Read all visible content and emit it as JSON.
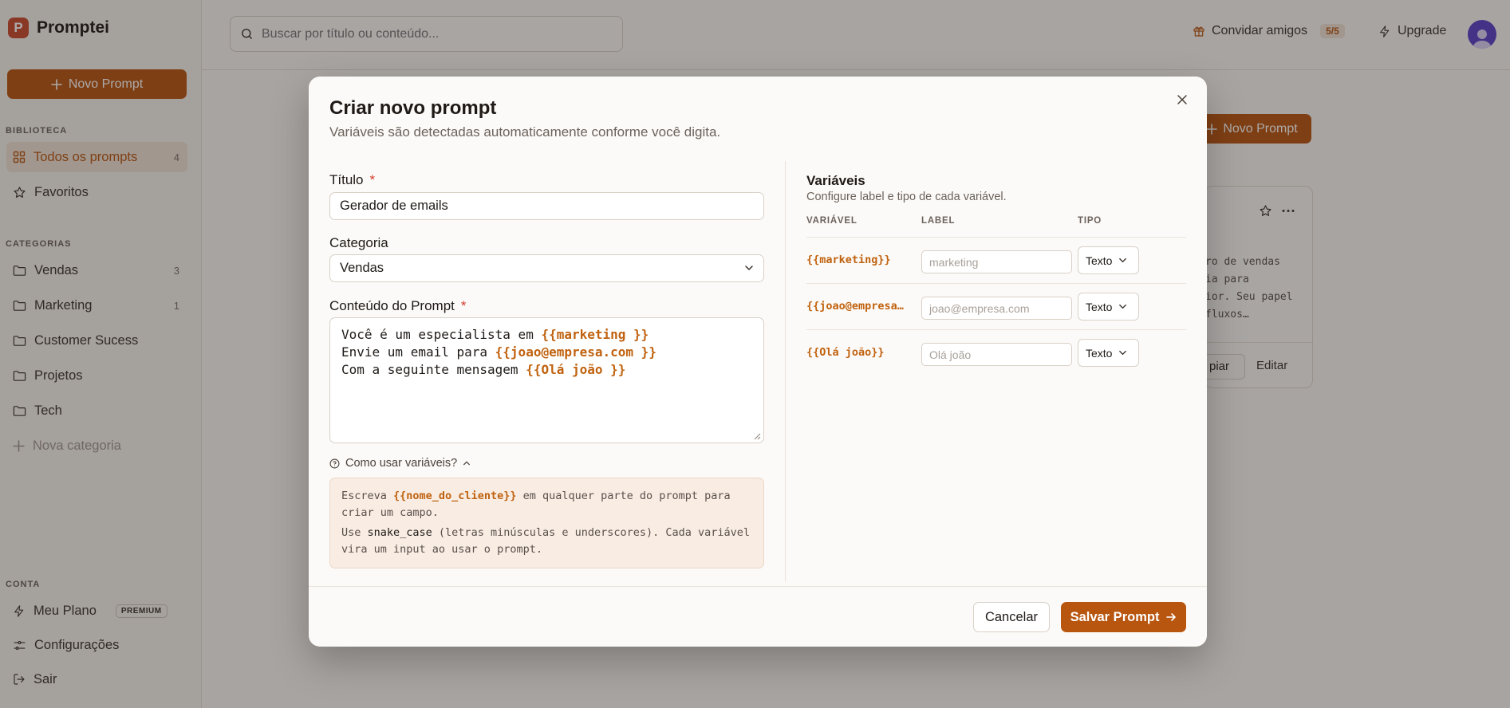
{
  "app": {
    "name": "Promptei",
    "logo_letter": "P"
  },
  "sidebar": {
    "new_prompt": "Novo Prompt",
    "library_head": "BIBLIOTECA",
    "all_prompts": {
      "label": "Todos os prompts",
      "count": "4"
    },
    "favorites": "Favoritos",
    "categories_head": "CATEGORIAS",
    "categories": [
      {
        "label": "Vendas",
        "count": "3"
      },
      {
        "label": "Marketing",
        "count": "1"
      },
      {
        "label": "Customer Sucess",
        "count": ""
      },
      {
        "label": "Projetos",
        "count": ""
      },
      {
        "label": "Tech",
        "count": ""
      }
    ],
    "new_category": "Nova categoria",
    "account_head": "CONTA",
    "plan": {
      "label": "Meu Plano",
      "badge": "PREMIUM"
    },
    "settings": "Configurações",
    "logout": "Sair"
  },
  "topbar": {
    "search_placeholder": "Buscar por título ou conteúdo...",
    "invite": {
      "label": "Convidar amigos",
      "count": "5/5"
    },
    "upgrade": "Upgrade"
  },
  "main": {
    "new_prompt": "Novo Prompt",
    "card": {
      "snippet": "ro de vendas\nia para\nior. Seu papel\nfluxos…",
      "copy": "piar",
      "edit": "Editar"
    }
  },
  "modal": {
    "title": "Criar novo prompt",
    "subtitle": "Variáveis são detectadas automaticamente conforme você digita.",
    "title_label": "Título",
    "required": "*",
    "title_value": "Gerador de emails",
    "category_label": "Categoria",
    "category_value": "Vendas",
    "content_label": "Conteúdo do Prompt",
    "content_lines": [
      {
        "text": "Você é um especialista em ",
        "var": "{{marketing }}"
      },
      {
        "text": "Envie um email para ",
        "var": "{{joao@empresa.com }}"
      },
      {
        "text": "Com a seguinte mensagem ",
        "var": "{{Olá joão }}"
      }
    ],
    "howto_label": "Como usar variáveis?",
    "help": {
      "p1_pre": "Escreva ",
      "p1_var": "{{nome_do_cliente}}",
      "p1_post": " em qualquer parte do prompt para criar um campo.",
      "p2_pre": "Use ",
      "p2_code": "snake_case",
      "p2_post": " (letras minúsculas e underscores). Cada variável vira um input ao usar o prompt."
    },
    "vars_title": "Variáveis",
    "vars_sub": "Configure label e tipo de cada variável.",
    "columns": {
      "variable": "VARIÁVEL",
      "label": "LABEL",
      "type": "TIPO"
    },
    "variables": [
      {
        "name": "{{marketing}}",
        "placeholder": "marketing",
        "type": "Texto"
      },
      {
        "name": "{{joao@empresa.com}}",
        "placeholder": "joao@empresa.com",
        "type": "Texto"
      },
      {
        "name": "{{Olá joão}}",
        "placeholder": "Olá joão",
        "type": "Texto"
      }
    ],
    "cancel": "Cancelar",
    "save": "Salvar Prompt"
  },
  "colors": {
    "accent": "#b8550f",
    "variable": "#c0620f",
    "logo": "#c84a2a",
    "avatar": "#5a40c8"
  },
  "icons": [
    "plus-icon",
    "grid-icon",
    "star-icon",
    "folder-icon",
    "bolt-icon",
    "sliders-icon",
    "logout-icon",
    "search-icon",
    "gift-icon",
    "user-icon",
    "close-icon",
    "chevron-down-icon",
    "help-circle-icon",
    "chevron-up-icon",
    "arrow-right-icon",
    "more-icon"
  ]
}
